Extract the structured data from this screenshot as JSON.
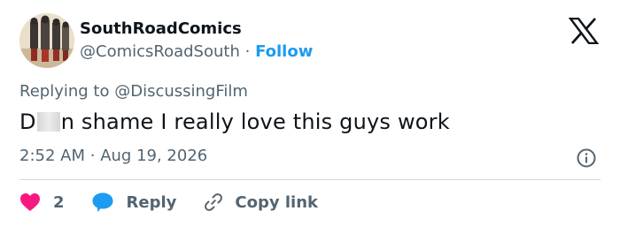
{
  "tweet": {
    "author": {
      "display_name": "SouthRoadComics",
      "handle": "@ComicsRoadSouth",
      "separator": "·",
      "follow_label": "Follow"
    },
    "replying_prefix": "Replying to",
    "replying_to": "@DiscussingFilm",
    "text_before_censor": "D",
    "text_after_censor": "n shame I really love this guys work",
    "time": "2:52 AM",
    "time_separator": "·",
    "date": "Aug 19, 2026"
  },
  "actions": {
    "like_count": "2",
    "reply_label": "Reply",
    "copy_link_label": "Copy link"
  },
  "colors": {
    "text_primary": "#0f1419",
    "text_secondary": "#536471",
    "link_blue": "#1d9bf0",
    "like_red": "#f91880",
    "divider": "#cfd9de"
  },
  "icons": {
    "brand": "x-logo-icon",
    "info": "info-icon",
    "like": "heart-icon",
    "reply": "speech-bubble-icon",
    "copy": "link-icon"
  }
}
